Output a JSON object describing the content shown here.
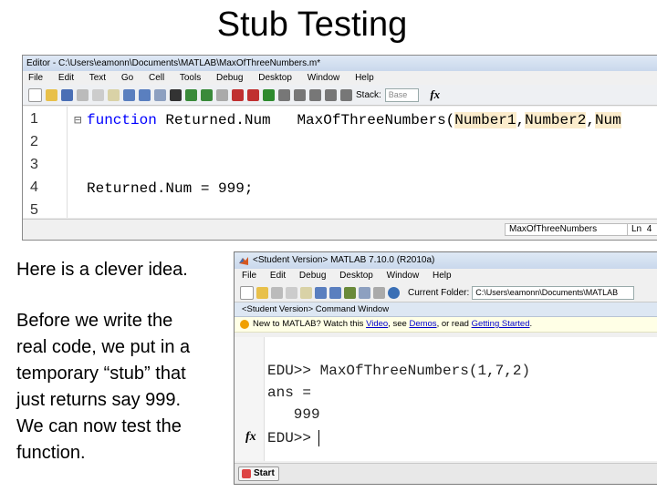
{
  "slide": {
    "title": "Stub Testing",
    "paragraph1": "Here is a clever idea.",
    "paragraph2_lines": [
      "Before we write the",
      "real code, we put in a",
      "temporary “stub” that",
      "just returns say 999.",
      "We can now test the",
      "function."
    ]
  },
  "editor": {
    "title": "Editor - C:\\Users\\eamonn\\Documents\\MATLAB\\MaxOfThreeNumbers.m*",
    "menu": [
      "File",
      "Edit",
      "Text",
      "Go",
      "Cell",
      "Tools",
      "Debug",
      "Desktop",
      "Window",
      "Help"
    ],
    "stack_label": "Stack:",
    "stack_value": "Base",
    "fx_label": "fx",
    "line_numbers": [
      "1",
      "2",
      "3",
      "4",
      "5"
    ],
    "code": {
      "line1_keyword": "function",
      "line1_output": "Returned.Num",
      "line1_name": "MaxOfThreeNumbers(",
      "line1_arg1": "Number1",
      "line1_sep1": ",",
      "line1_arg2": "Number2",
      "line1_sep2": ",",
      "line1_arg3": "Num",
      "line4": "Returned.Num = 999;"
    },
    "status_function": "MaxOfThreeNumbers",
    "status_ln": "Ln",
    "status_ln_value": "4"
  },
  "matlab": {
    "title": "<Student Version> MATLAB 7.10.0 (R2010a)",
    "menu": [
      "File",
      "Edit",
      "Debug",
      "Desktop",
      "Window",
      "Help"
    ],
    "current_folder_label": "Current Folder:",
    "current_folder_value": "C:\\Users\\eamonn\\Documents\\MATLAB",
    "command_window_title": "<Student Version> Command Window",
    "notice_prefix": "New to MATLAB? Watch this ",
    "notice_video": "Video",
    "notice_mid1": ", see ",
    "notice_demos": "Demos",
    "notice_mid2": ", or read ",
    "notice_started": "Getting Started",
    "notice_suffix": ".",
    "cmd_line1": "EDU>> MaxOfThreeNumbers(1,7,2)",
    "cmd_line2": "ans =",
    "cmd_line3": "   999",
    "cmd_prompt": "EDU>>",
    "fx_label": "fx",
    "start_label": "Start"
  },
  "colors": {
    "keyword": "#0000ff",
    "arg_highlight": "#fbeccc",
    "link": "#0000cc"
  }
}
